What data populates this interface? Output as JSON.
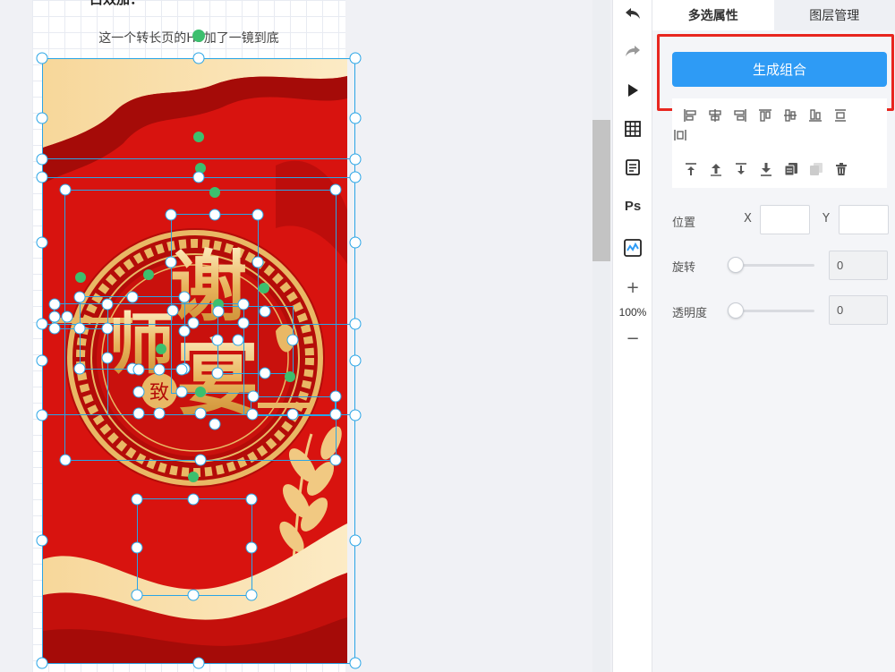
{
  "canvas": {
    "top_text": "白效加：",
    "caption": "这一个转长页的H5加了一镜到底",
    "poster": {
      "title_chars": [
        "谢",
        "师",
        "宴"
      ],
      "seal_text": "致",
      "colors": {
        "red": "#d8130f",
        "dark_red": "#b20d0b",
        "gold": "#f3d08a",
        "light_gold": "#fbe6b4"
      }
    },
    "selection_color": "#2aa5e6",
    "rotate_handle_color": "#3cbf6e"
  },
  "toolbar": {
    "items": [
      {
        "name": "undo-icon"
      },
      {
        "name": "redo-icon"
      },
      {
        "name": "play-icon"
      },
      {
        "name": "table-icon"
      },
      {
        "name": "document-icon"
      },
      {
        "name": "ps-icon",
        "label": "Ps"
      },
      {
        "name": "chart-icon"
      }
    ],
    "zoom_in": "+",
    "zoom_level": "100%",
    "zoom_out": "−"
  },
  "panel": {
    "tabs": [
      {
        "label": "多选属性",
        "active": true
      },
      {
        "label": "图层管理",
        "active": false
      }
    ],
    "generate_button": "生成组合",
    "position_label": "位置",
    "x_label": "X",
    "y_label": "Y",
    "x_value": "",
    "y_value": "",
    "rotate_label": "旋转",
    "rotate_value": "0",
    "opacity_label": "透明度",
    "opacity_value": "0",
    "accent_color": "#2e9bf5",
    "highlight_color": "#e8261f"
  }
}
